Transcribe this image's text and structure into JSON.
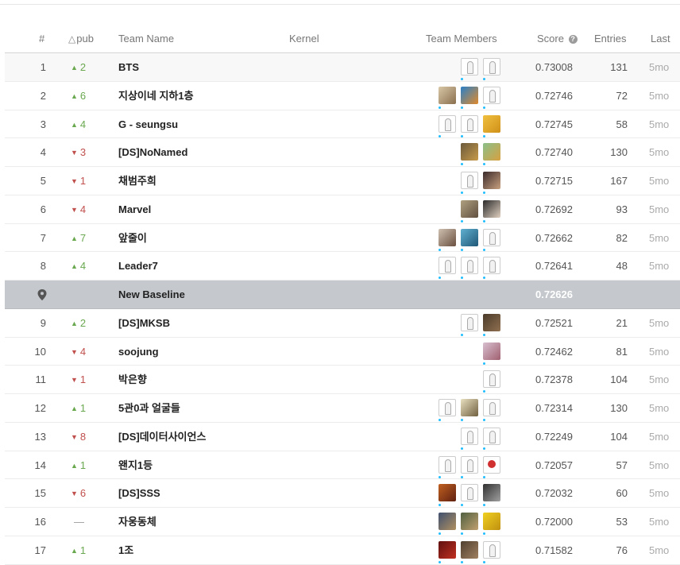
{
  "header": {
    "rank": "#",
    "delta_pub": "pub",
    "team_name": "Team Name",
    "kernel": "Kernel",
    "team_members": "Team Members",
    "score": "Score",
    "entries": "Entries",
    "last": "Last"
  },
  "colors": {
    "up": "#6aa84f",
    "down": "#c0504d",
    "baseline_row": "#c5c9cd",
    "accent": "#20beff"
  },
  "rows": [
    {
      "rank": "1",
      "dir": "up",
      "delta": "2",
      "team": "BTS",
      "score": "0.73008",
      "entries": "131",
      "last": "5mo",
      "avatars": [
        "default",
        "default"
      ]
    },
    {
      "rank": "2",
      "dir": "up",
      "delta": "6",
      "team": "지상이네 지하1층",
      "score": "0.72746",
      "entries": "72",
      "last": "5mo",
      "avatars": [
        "photo-1",
        "photo-2",
        "default"
      ]
    },
    {
      "rank": "3",
      "dir": "up",
      "delta": "4",
      "team": "G - seungsu",
      "score": "0.72745",
      "entries": "58",
      "last": "5mo",
      "avatars": [
        "default",
        "default",
        "photo-3"
      ]
    },
    {
      "rank": "4",
      "dir": "down",
      "delta": "3",
      "team": "[DS]NoNamed",
      "score": "0.72740",
      "entries": "130",
      "last": "5mo",
      "avatars": [
        "photo-4",
        "photo-5"
      ]
    },
    {
      "rank": "5",
      "dir": "down",
      "delta": "1",
      "team": "채범주희",
      "score": "0.72715",
      "entries": "167",
      "last": "5mo",
      "avatars": [
        "default",
        "photo-6"
      ]
    },
    {
      "rank": "6",
      "dir": "down",
      "delta": "4",
      "team": "Marvel",
      "score": "0.72692",
      "entries": "93",
      "last": "5mo",
      "avatars": [
        "photo-7",
        "photo-8"
      ]
    },
    {
      "rank": "7",
      "dir": "up",
      "delta": "7",
      "team": "앞줄이",
      "score": "0.72662",
      "entries": "82",
      "last": "5mo",
      "avatars": [
        "photo-9",
        "photo-10",
        "default"
      ]
    },
    {
      "rank": "8",
      "dir": "up",
      "delta": "4",
      "team": "Leader7",
      "score": "0.72641",
      "entries": "48",
      "last": "5mo",
      "avatars": [
        "default",
        "default",
        "default"
      ]
    },
    {
      "rank": "",
      "dir": "baseline",
      "delta": "",
      "team": "New Baseline",
      "score": "0.72626",
      "entries": "",
      "last": "",
      "avatars": []
    },
    {
      "rank": "9",
      "dir": "up",
      "delta": "2",
      "team": "[DS]MKSB",
      "score": "0.72521",
      "entries": "21",
      "last": "5mo",
      "avatars": [
        "default",
        "photo-11"
      ]
    },
    {
      "rank": "10",
      "dir": "down",
      "delta": "4",
      "team": "soojung",
      "score": "0.72462",
      "entries": "81",
      "last": "5mo",
      "avatars": [
        "photo-12"
      ]
    },
    {
      "rank": "11",
      "dir": "down",
      "delta": "1",
      "team": "박은향",
      "score": "0.72378",
      "entries": "104",
      "last": "5mo",
      "avatars": [
        "default"
      ]
    },
    {
      "rank": "12",
      "dir": "up",
      "delta": "1",
      "team": "5관0과 얼굴들",
      "score": "0.72314",
      "entries": "130",
      "last": "5mo",
      "avatars": [
        "default",
        "photo-13",
        "default"
      ]
    },
    {
      "rank": "13",
      "dir": "down",
      "delta": "8",
      "team": "[DS]데이터사이언스",
      "score": "0.72249",
      "entries": "104",
      "last": "5mo",
      "avatars": [
        "default",
        "default"
      ]
    },
    {
      "rank": "14",
      "dir": "up",
      "delta": "1",
      "team": "왠지1등",
      "score": "0.72057",
      "entries": "57",
      "last": "5mo",
      "avatars": [
        "default",
        "default",
        "photo-14"
      ]
    },
    {
      "rank": "15",
      "dir": "down",
      "delta": "6",
      "team": "[DS]SSS",
      "score": "0.72032",
      "entries": "60",
      "last": "5mo",
      "avatars": [
        "photo-15",
        "default",
        "photo-16"
      ]
    },
    {
      "rank": "16",
      "dir": "flat",
      "delta": "—",
      "team": "자웅동체",
      "score": "0.72000",
      "entries": "53",
      "last": "5mo",
      "avatars": [
        "photo-17",
        "photo-18",
        "photo-19"
      ]
    },
    {
      "rank": "17",
      "dir": "up",
      "delta": "1",
      "team": "1조",
      "score": "0.71582",
      "entries": "76",
      "last": "5mo",
      "avatars": [
        "photo-20",
        "photo-21",
        "default"
      ]
    }
  ]
}
